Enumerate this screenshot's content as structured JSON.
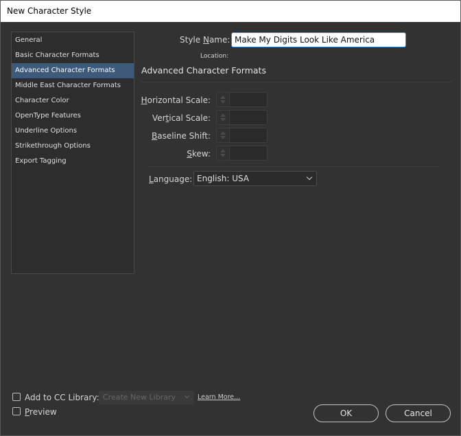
{
  "window": {
    "title": "New Character Style"
  },
  "sidebar": {
    "items": [
      {
        "label": "General"
      },
      {
        "label": "Basic Character Formats"
      },
      {
        "label": "Advanced Character Formats",
        "active": true
      },
      {
        "label": "Middle East Character Formats"
      },
      {
        "label": "Character Color"
      },
      {
        "label": "OpenType Features"
      },
      {
        "label": "Underline Options"
      },
      {
        "label": "Strikethrough Options"
      },
      {
        "label": "Export Tagging"
      }
    ]
  },
  "header": {
    "style_name_label_pre": "Style ",
    "style_name_label_ul": "N",
    "style_name_label_post": "ame:",
    "style_name_value": "Make My Digits Look Like America",
    "location_label": "Location:"
  },
  "section": {
    "title": "Advanced Character Formats",
    "fields": {
      "horizontal_scale": {
        "ul": "H",
        "rest": "orizontal Scale:",
        "value": ""
      },
      "vertical_scale": {
        "pre": "Ver",
        "ul": "t",
        "rest": "ical Scale:",
        "value": ""
      },
      "baseline_shift": {
        "ul": "B",
        "rest": "aseline Shift:",
        "value": ""
      },
      "skew": {
        "ul": "S",
        "rest": "kew:",
        "value": ""
      }
    },
    "language": {
      "ul": "L",
      "rest": "anguage:",
      "value": "English: USA"
    }
  },
  "footer": {
    "add_cc_label": "Add to CC Library:",
    "cc_select_placeholder": "Create New Library",
    "learn_more": "Learn More...",
    "preview_ul": "P",
    "preview_rest": "review",
    "ok_label": "OK",
    "cancel_label": "Cancel"
  }
}
